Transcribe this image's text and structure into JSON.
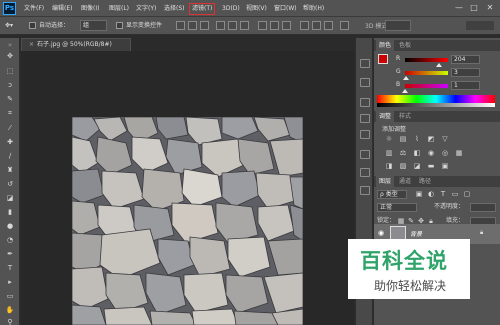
{
  "app": {
    "logo": "Ps"
  },
  "menu": [
    {
      "label": "文件(F)"
    },
    {
      "label": "编辑(E)"
    },
    {
      "label": "图像(I)"
    },
    {
      "label": "图层(L)"
    },
    {
      "label": "文字(Y)"
    },
    {
      "label": "选择(S)"
    },
    {
      "label": "滤镜(T)",
      "highlighted": true
    },
    {
      "label": "3D(D)"
    },
    {
      "label": "视图(V)"
    },
    {
      "label": "窗口(W)"
    },
    {
      "label": "帮助(H)"
    }
  ],
  "window_controls": {
    "minimize": "—",
    "maximize": "□",
    "close": "✕"
  },
  "options_bar": {
    "auto_select_label": "自动选择：",
    "auto_select_value": "组",
    "show_transform_label": "显示变换控件",
    "mode_3d_label": "3D 模式："
  },
  "document": {
    "tab_title": "石子.jpg @ 50%(RGB/8#)",
    "close_glyph": "×"
  },
  "color_panel": {
    "tabs": [
      "颜色",
      "色板"
    ],
    "channels": [
      {
        "label": "R",
        "value": "204",
        "level": 0.8
      },
      {
        "label": "G",
        "value": "3",
        "level": 0.012
      },
      {
        "label": "B",
        "value": "1",
        "level": 0.004
      }
    ],
    "foreground": "#cc0301",
    "background": "#ffffff"
  },
  "adjustments_panel": {
    "tabs": [
      "调整",
      "样式"
    ],
    "add_label": "添加调整"
  },
  "layers_panel": {
    "tabs": [
      "图层",
      "通道",
      "路径"
    ],
    "filter_label": "ρ 类型",
    "blend_mode": "正常",
    "opacity_label": "不透明度：",
    "lock_label": "锁定：",
    "fill_label": "填充：",
    "layer_name": "背景"
  },
  "watermark": {
    "title": "百科全说",
    "subtitle": "助你轻松解决"
  }
}
